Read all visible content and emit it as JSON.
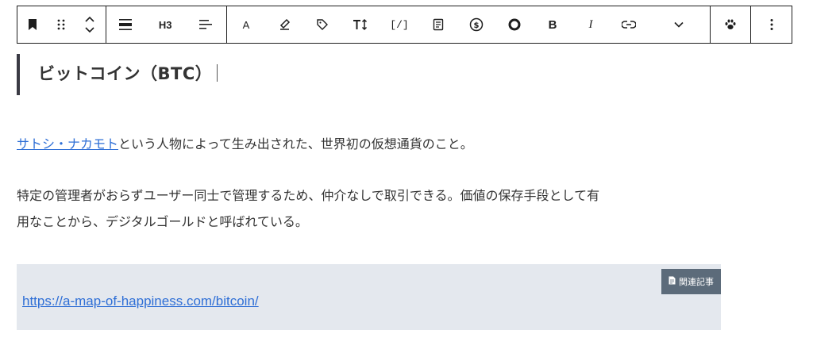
{
  "toolbar": {
    "heading_level": "H3",
    "text_color_label": "A",
    "inline_code_label": "[/]",
    "bold_label": "B",
    "italic_label": "I"
  },
  "heading": {
    "text": "ビットコイン（BTC）"
  },
  "paragraphs": {
    "p1_link": "サトシ・ナカモト",
    "p1_rest": "という人物によって生み出された、世界初の仮想通貨のこと。",
    "p2_line1": "特定の管理者がおらずユーザー同士で管理するため、仲介なしで取引できる。価値の保存手段として有",
    "p2_line2": "用なことから、デジタルゴールドと呼ばれている。"
  },
  "related": {
    "badge_label": "関連記事",
    "url": "https://a-map-of-happiness.com/bitcoin/"
  },
  "colors": {
    "link": "#2f6fd6",
    "card_bg": "#e4e8ee",
    "badge_bg": "#5c6b7a",
    "heading_bar": "#3a3a44"
  }
}
